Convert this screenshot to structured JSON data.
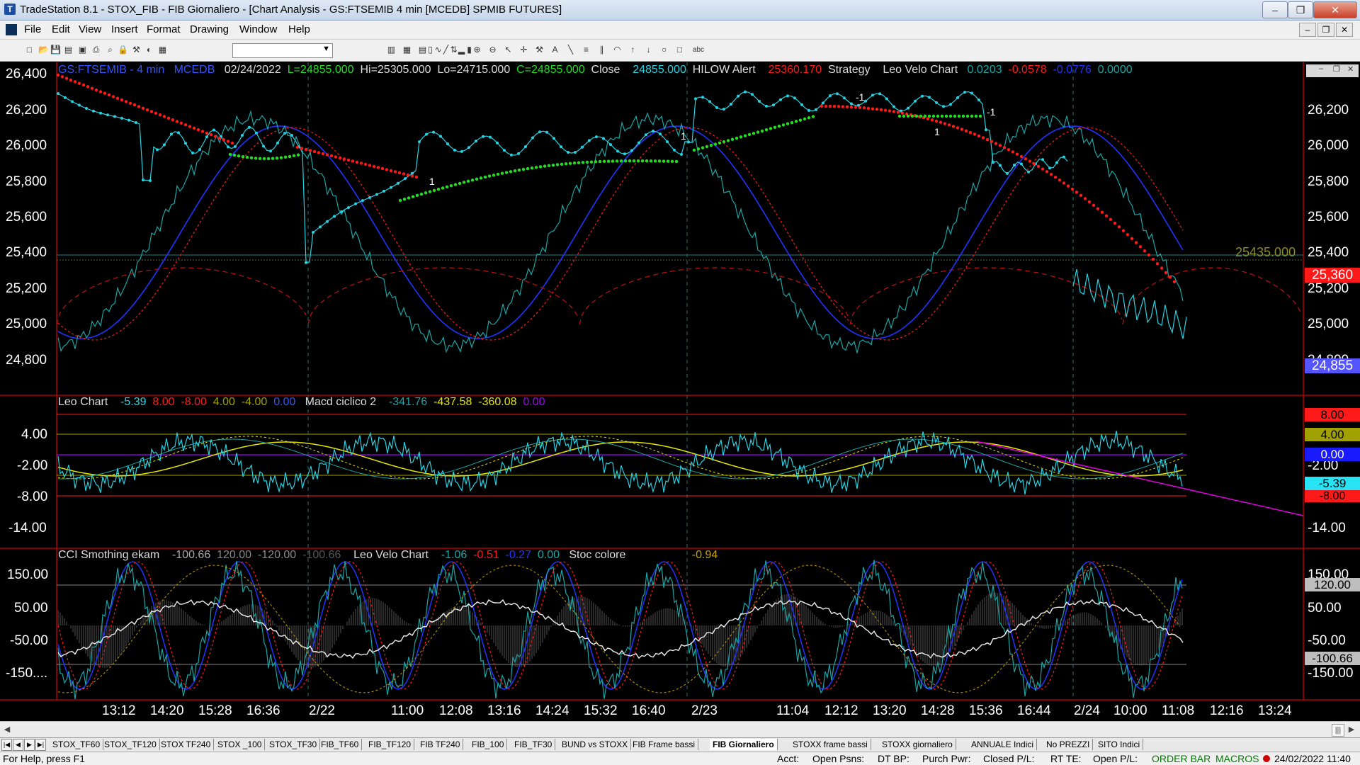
{
  "window": {
    "title": "TradeStation 8.1 - STOX_FIB - FIB Giornaliero - [Chart Analysis - GS:FTSEMIB  4 min  [MCEDB] SPMIB FUTURES]",
    "controls": {
      "minimize": "–",
      "maximize": "❐",
      "close": "✕"
    }
  },
  "menu": {
    "items": [
      "File",
      "Edit",
      "View",
      "Insert",
      "Format",
      "Drawing",
      "Window",
      "Help"
    ],
    "mdi_controls": [
      "–",
      "❐",
      "✕"
    ]
  },
  "toolbar": {
    "combo_value": "",
    "icons": [
      "new-icon",
      "open-icon",
      "save-icon",
      "save-all-icon",
      "folder-icon",
      "print-icon",
      "print-preview-icon",
      "lock-icon",
      "tools-icon",
      "color-icon",
      "workspace-icon",
      "chart-icon",
      "table-icon",
      "grid-icon",
      "indicator-icon",
      "strategy-icon",
      "bar-chart-icon",
      "candle-icon",
      "line-chart-icon",
      "volume-icon",
      "zoom-in-icon",
      "zoom-out-icon",
      "pointer-icon",
      "crosshair-icon",
      "hammer-icon",
      "text-icon",
      "trendline-icon",
      "fib-icon",
      "channel-icon",
      "gann-icon",
      "arrow-up-icon",
      "arrow-down-icon",
      "circle-icon",
      "square-icon",
      "abc-icon"
    ]
  },
  "chart": {
    "header": {
      "symbol": "GS:FTSEMIB - 4 min",
      "feed": "MCEDB",
      "date": "02/24/2022",
      "last": "L=24855.000",
      "hi": "Hi=25305.000",
      "lo": "Lo=24715.000",
      "close": "C=24855.000",
      "close_label": "Close",
      "close_value": "24855.000",
      "alert": "HILOW Alert",
      "alert_value": "25360.170",
      "strategy": "Strategy",
      "velo": "Leo Velo Chart",
      "v1": "0.0203",
      "v2": "-0.0578",
      "v3": "-0.0776",
      "v4": "0.0000"
    },
    "price_axis": {
      "ticks": [
        "26,400",
        "26,200",
        "26,000",
        "25,800",
        "25,600",
        "25,400",
        "25,200",
        "25,000",
        "24,800"
      ],
      "right_ticks": [
        "26,400",
        "26,200",
        "26,000",
        "25,800",
        "25,600",
        "25,400",
        "25,200",
        "25,000",
        "24,800"
      ],
      "level_label": "25435.000",
      "badge_hilow": "25,360",
      "badge_last": "24,855"
    },
    "trade_labels": [
      "1",
      "-1",
      "1",
      "-1",
      "1",
      "-1",
      "1"
    ],
    "panel2": {
      "name": "Leo Chart",
      "v1": "-5.39",
      "v2": "8.00",
      "v3": "-8.00",
      "v4": "4.00",
      "v5": "-4.00",
      "v6": "0.00",
      "macd_name": "Macd ciclico 2",
      "m1": "-341.76",
      "m2": "-437.58",
      "m3": "-360.08",
      "m4": "0.00",
      "ticks": [
        "4.00",
        "-2.00",
        "-8.00",
        "-14.00"
      ],
      "right_ticks": [
        "-2.00",
        "-14.00"
      ],
      "badges": [
        "8.00",
        "4.00",
        "0.00",
        "-5.39",
        "-8.00"
      ]
    },
    "panel3": {
      "name": "CCI Smothing ekam",
      "c1": "-100.66",
      "c2": "120.00",
      "c3": "-120.00",
      "c4": "-100.66",
      "velo_name": "Leo Velo Chart",
      "l1": "-1.06",
      "l2": "-0.51",
      "l3": "-0.27",
      "l4": "0.00",
      "stoc_name": "Stoc colore",
      "s1": "-0.94",
      "ticks": [
        "150.00",
        "50.00",
        "-50.00",
        "-150...."
      ],
      "right_ticks": [
        "150.00",
        "50.00",
        "-50.00",
        "-150.00"
      ],
      "badges": [
        "120.00",
        "-100.66"
      ]
    },
    "time_axis": [
      "13:12",
      "14:20",
      "15:28",
      "16:36",
      "2/22",
      "11:00",
      "12:08",
      "13:16",
      "14:24",
      "15:32",
      "16:40",
      "2/23",
      "11:04",
      "12:12",
      "13:20",
      "14:28",
      "15:36",
      "16:44",
      "2/24",
      "10:00",
      "11:08",
      "12:16",
      "13:24"
    ]
  },
  "tabs": [
    "STOX_TF60",
    "STOX_TF120",
    "STOX TF240",
    "STOX _100",
    "STOX_TF30",
    "FIB_TF60",
    "FIB_TF120",
    "FIB TF240",
    "FIB_100",
    "FIB_TF30",
    "BUND vs STOXX",
    "FIB Frame bassi",
    "FIB Giornaliero",
    "STOXX frame bassi",
    "STOXX giornaliero",
    "ANNUALE Indici",
    "No PREZZI",
    "SITO Indici"
  ],
  "active_tab": "FIB Giornaliero",
  "status": {
    "help": "For Help, press F1",
    "acct": "Acct:",
    "open_psns": "Open Psns:",
    "dt_bp": "DT BP:",
    "purch_pwr": "Purch Pwr:",
    "closed_pl": "Closed P/L:",
    "rt_te": "RT TE:",
    "open_pl": "Open P/L:",
    "order_bar": "ORDER BAR",
    "macros": "MACROS",
    "datetime": "24/02/2022 11:40"
  },
  "colors": {
    "cyan": "#27d3e3",
    "red": "#ff1a1a",
    "green": "#22dd22",
    "blue": "#2233ff",
    "teal": "#1aa5a5",
    "yellow": "#e5e500",
    "magenta": "#e000e0",
    "olive": "#c8a000"
  }
}
